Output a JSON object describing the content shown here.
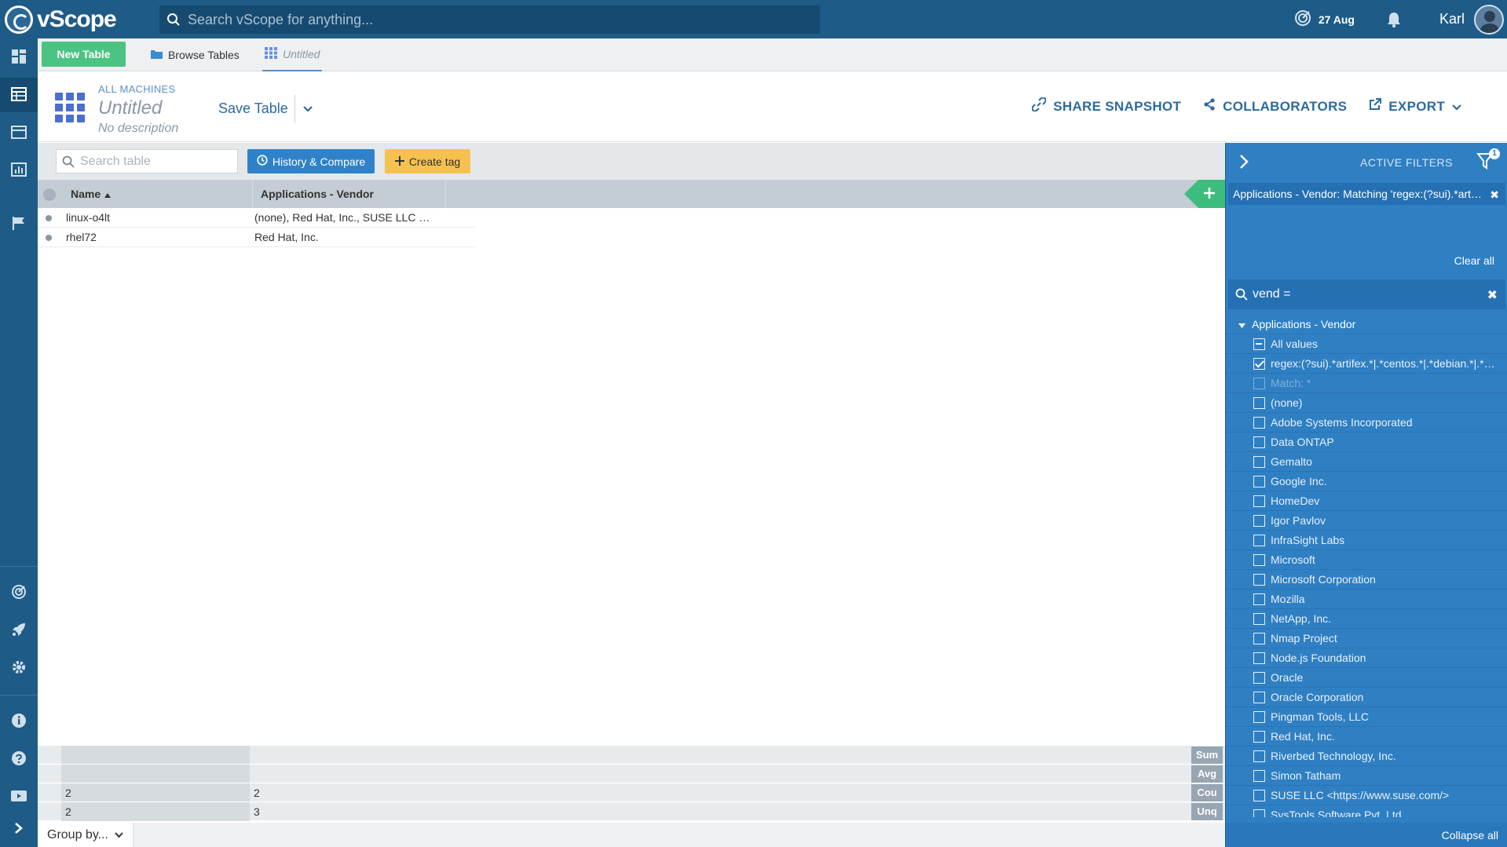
{
  "topbar": {
    "logo_text": "vScope",
    "search_placeholder": "Search vScope for anything...",
    "date": "27 Aug",
    "user_name": "Karl"
  },
  "tabbar": {
    "new_table": "New Table",
    "browse_tables": "Browse Tables",
    "current_tab": "Untitled"
  },
  "header": {
    "breadcrumb": "ALL MACHINES",
    "title": "Untitled",
    "description": "No description",
    "save_table": "Save Table",
    "actions": {
      "share": "SHARE SNAPSHOT",
      "collaborators": "COLLABORATORS",
      "export": "EXPORT"
    }
  },
  "toolbar": {
    "search_placeholder": "Search table",
    "history_compare": "History & Compare",
    "create_tag": "Create tag"
  },
  "table": {
    "columns": [
      "Name",
      "Applications - Vendor"
    ],
    "rows": [
      {
        "name": "linux-o4lt",
        "vendor": "(none), Red Hat, Inc., SUSE LLC <https://www.suse.com/>"
      },
      {
        "name": "rhel72",
        "vendor": "Red Hat, Inc."
      }
    ],
    "summary": [
      {
        "label": "Sum",
        "name": "",
        "vendor": ""
      },
      {
        "label": "Avg",
        "name": "",
        "vendor": ""
      },
      {
        "label": "Cou",
        "name": "2",
        "vendor": "2"
      },
      {
        "label": "Unq",
        "name": "2",
        "vendor": "3"
      }
    ],
    "group_by": "Group by..."
  },
  "filters": {
    "title": "ACTIVE FILTERS",
    "badge": "1",
    "active_chip": "Applications - Vendor: Matching 'regex:(?sui).*artifex.*|.*centos.*|.*debian.*'",
    "clear_all": "Clear all",
    "search_value": "vend =",
    "group_label": "Applications - Vendor",
    "items": [
      {
        "label": "All values",
        "state": "partial"
      },
      {
        "label": "regex:(?sui).*artifex.*|.*centos.*|.*debian.*|.*redhat.*",
        "state": "checked"
      },
      {
        "label": "Match: *",
        "state": "dim"
      },
      {
        "label": "(none)",
        "state": "unchecked"
      },
      {
        "label": "Adobe Systems Incorporated",
        "state": "unchecked"
      },
      {
        "label": "Data ONTAP",
        "state": "unchecked"
      },
      {
        "label": "Gemalto",
        "state": "unchecked"
      },
      {
        "label": "Google Inc.",
        "state": "unchecked"
      },
      {
        "label": "HomeDev",
        "state": "unchecked"
      },
      {
        "label": "Igor Pavlov",
        "state": "unchecked"
      },
      {
        "label": "InfraSight Labs",
        "state": "unchecked"
      },
      {
        "label": "Microsoft",
        "state": "unchecked"
      },
      {
        "label": "Microsoft Corporation",
        "state": "unchecked"
      },
      {
        "label": "Mozilla",
        "state": "unchecked"
      },
      {
        "label": "NetApp, Inc.",
        "state": "unchecked"
      },
      {
        "label": "Nmap Project",
        "state": "unchecked"
      },
      {
        "label": "Node.js Foundation",
        "state": "unchecked"
      },
      {
        "label": "Oracle",
        "state": "unchecked"
      },
      {
        "label": "Oracle Corporation",
        "state": "unchecked"
      },
      {
        "label": "Pingman Tools, LLC",
        "state": "unchecked"
      },
      {
        "label": "Red Hat, Inc.",
        "state": "unchecked"
      },
      {
        "label": "Riverbed Technology, Inc.",
        "state": "unchecked"
      },
      {
        "label": "Simon Tatham",
        "state": "unchecked"
      },
      {
        "label": "SUSE LLC <https://www.suse.com/>",
        "state": "unchecked"
      },
      {
        "label": "SysTools Software Pvt. Ltd",
        "state": "unchecked"
      }
    ],
    "collapse_all": "Collapse all"
  },
  "colors": {
    "brand": "#1f5b87",
    "panel": "#2f7fc3",
    "new_table": "#4ac383",
    "history_button": "#2f82c9",
    "tag_button": "#f6c14e"
  },
  "icons": {
    "top": [
      "vscope-logo-icon",
      "search-icon",
      "discovery-icon",
      "bell-icon",
      "avatar"
    ],
    "left_nav": [
      "dashboard-icon",
      "table-icon",
      "calendar-icon",
      "report-icon",
      "flag-icon",
      "discovery-icon",
      "rocket-icon",
      "gear-icon",
      "info-icon",
      "help-icon",
      "video-icon",
      "chevron-right-icon"
    ]
  }
}
